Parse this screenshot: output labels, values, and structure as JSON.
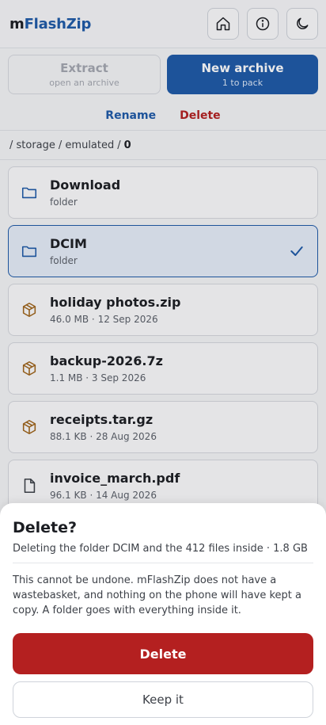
{
  "app": {
    "brand_prefix": "m",
    "brand_suffix": "FlashZip"
  },
  "header": {
    "buttons": [
      "home-icon",
      "info-icon",
      "moon-icon"
    ]
  },
  "actions": {
    "extract": {
      "label": "Extract",
      "sub": "open an archive"
    },
    "new_archive": {
      "label": "New archive",
      "sub": "1 to pack"
    }
  },
  "links": {
    "rename": "Rename",
    "delete": "Delete"
  },
  "breadcrumb": {
    "segments": [
      "/ storage",
      "/ emulated",
      "/"
    ],
    "current": "0"
  },
  "files": [
    {
      "name": "Download",
      "meta": "folder",
      "icon": "folder-icon",
      "selected": false
    },
    {
      "name": "DCIM",
      "meta": "folder",
      "icon": "folder-icon",
      "selected": true
    },
    {
      "name": "holiday photos.zip",
      "meta": "46.0 MB · 12 Sep 2026",
      "icon": "archive-box-icon",
      "selected": false
    },
    {
      "name": "backup-2026.7z",
      "meta": "1.1 MB · 3 Sep 2026",
      "icon": "archive-box-icon",
      "selected": false
    },
    {
      "name": "receipts.tar.gz",
      "meta": "88.1 KB · 28 Aug 2026",
      "icon": "archive-box-icon",
      "selected": false
    },
    {
      "name": "invoice_march.pdf",
      "meta": "96.1 KB · 14 Aug 2026",
      "icon": "document-icon",
      "selected": false
    }
  ],
  "dialog": {
    "title": "Delete?",
    "subtitle": "Deleting the folder DCIM and the 412 files inside · 1.8 GB",
    "warning": "This cannot be undone. mFlashZip does not have a wastebasket, and nothing on the phone will have kept a copy. A folder goes with everything inside it.",
    "confirm_label": "Delete",
    "cancel_label": "Keep it"
  },
  "colors": {
    "accent": "#1e5aa8",
    "danger": "#b42020",
    "archive_icon": "#a0651a"
  }
}
